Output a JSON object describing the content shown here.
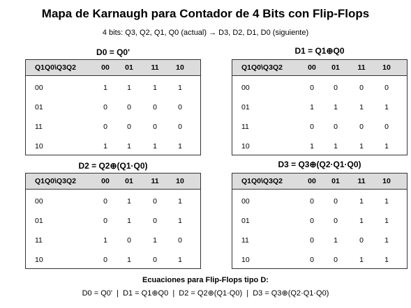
{
  "title": "Mapa de Karnaugh para Contador de 4 Bits con Flip-Flops",
  "subtitle": "4 bits: Q3, Q2, Q1, Q0 (actual) → D3, D2, D1, D0 (siguiente)",
  "header": [
    "Q1Q0\\Q3Q2",
    "00",
    "01",
    "11",
    "10"
  ],
  "maps": [
    {
      "title": "D0 = Q0'",
      "rows": [
        {
          "label": "00",
          "cells": [
            "1",
            "1",
            "1",
            "1"
          ]
        },
        {
          "label": "01",
          "cells": [
            "0",
            "0",
            "0",
            "0"
          ]
        },
        {
          "label": "11",
          "cells": [
            "0",
            "0",
            "0",
            "0"
          ]
        },
        {
          "label": "10",
          "cells": [
            "1",
            "1",
            "1",
            "1"
          ]
        }
      ]
    },
    {
      "title": "D1 = Q1⊕Q0",
      "rows": [
        {
          "label": "00",
          "cells": [
            "0",
            "0",
            "0",
            "0"
          ]
        },
        {
          "label": "01",
          "cells": [
            "1",
            "1",
            "1",
            "1"
          ]
        },
        {
          "label": "11",
          "cells": [
            "0",
            "0",
            "0",
            "0"
          ]
        },
        {
          "label": "10",
          "cells": [
            "1",
            "1",
            "1",
            "1"
          ]
        }
      ]
    },
    {
      "title": "D2 = Q2⊕(Q1·Q0)",
      "rows": [
        {
          "label": "00",
          "cells": [
            "0",
            "1",
            "0",
            "1"
          ]
        },
        {
          "label": "01",
          "cells": [
            "0",
            "1",
            "0",
            "1"
          ]
        },
        {
          "label": "11",
          "cells": [
            "1",
            "0",
            "1",
            "0"
          ]
        },
        {
          "label": "10",
          "cells": [
            "0",
            "1",
            "0",
            "1"
          ]
        }
      ]
    },
    {
      "title": "D3 = Q3⊕(Q2·Q1·Q0)",
      "rows": [
        {
          "label": "00",
          "cells": [
            "0",
            "0",
            "1",
            "1"
          ]
        },
        {
          "label": "01",
          "cells": [
            "0",
            "0",
            "1",
            "1"
          ]
        },
        {
          "label": "11",
          "cells": [
            "0",
            "1",
            "0",
            "1"
          ]
        },
        {
          "label": "10",
          "cells": [
            "0",
            "0",
            "1",
            "1"
          ]
        }
      ]
    }
  ],
  "equations": {
    "title": "Ecuaciones para Flip-Flops tipo D:",
    "text": "D0 = Q0'  |  D1 = Q1⊕Q0  |  D2 = Q2⊕(Q1·Q0)  |  D3 = Q3⊕(Q2·Q1·Q0)"
  }
}
